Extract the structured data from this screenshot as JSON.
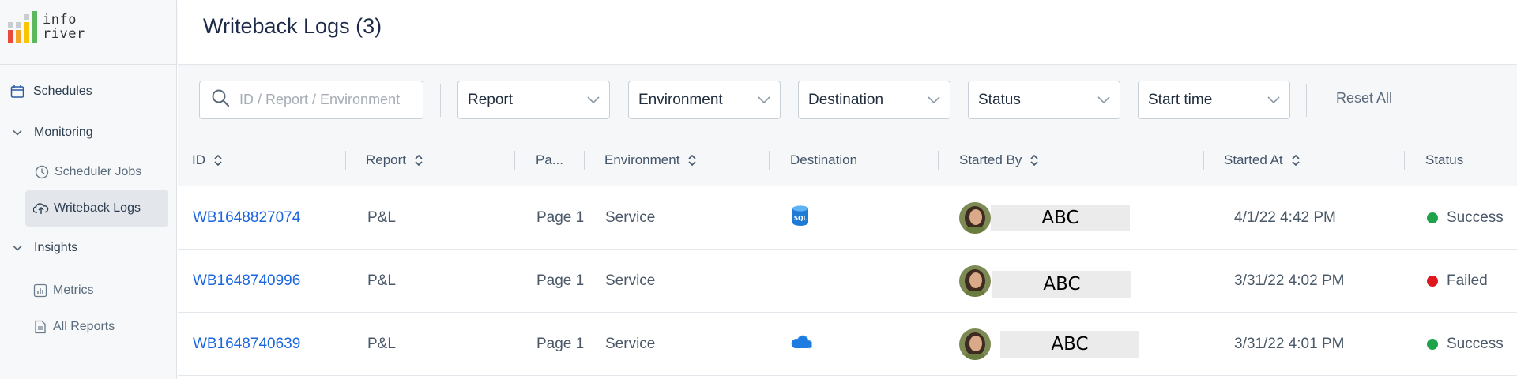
{
  "app": {
    "logo_line1": "info",
    "logo_line2": "river"
  },
  "sidebar": {
    "items": [
      {
        "label": "Schedules",
        "icon": "calendar-icon"
      },
      {
        "label": "Monitoring",
        "icon": "chevron-down-icon"
      },
      {
        "label": "Scheduler Jobs",
        "icon": "clock-icon"
      },
      {
        "label": "Writeback Logs",
        "icon": "cloud-upload-icon"
      },
      {
        "label": "Insights",
        "icon": "chevron-down-icon"
      },
      {
        "label": "Metrics",
        "icon": "bar-chart-icon"
      },
      {
        "label": "All Reports",
        "icon": "document-icon"
      }
    ]
  },
  "header": {
    "title": "Writeback Logs (3)"
  },
  "filters": {
    "search_placeholder": "ID / Report / Environment",
    "report": "Report",
    "environment": "Environment",
    "destination": "Destination",
    "status": "Status",
    "start_time": "Start time",
    "reset_label": "Reset All"
  },
  "table": {
    "columns": [
      "ID",
      "Report",
      "Pa...",
      "Environment",
      "Destination",
      "Started By",
      "Started At",
      "Status"
    ],
    "rows": [
      {
        "id": "WB1648827074",
        "report": "P&L",
        "page": "Page 1",
        "environment": "Service",
        "destination": "sql-database-icon",
        "started_by": "ABC",
        "started_at": "4/1/22 4:42 PM",
        "status": "Success",
        "status_color": "#1fa34a"
      },
      {
        "id": "WB1648740996",
        "report": "P&L",
        "page": "Page 1",
        "environment": "Service",
        "destination": "",
        "started_by": "ABC",
        "started_at": "3/31/22 4:02 PM",
        "status": "Failed",
        "status_color": "#e0161d"
      },
      {
        "id": "WB1648740639",
        "report": "P&L",
        "page": "Page 1",
        "environment": "Service",
        "destination": "onedrive-cloud-icon",
        "started_by": "ABC",
        "started_at": "3/31/22 4:01 PM",
        "status": "Success",
        "status_color": "#1fa34a"
      }
    ]
  },
  "colors": {
    "link": "#1a66e0",
    "success": "#1fa34a",
    "failed": "#e0161d",
    "title": "#1c2a48"
  }
}
